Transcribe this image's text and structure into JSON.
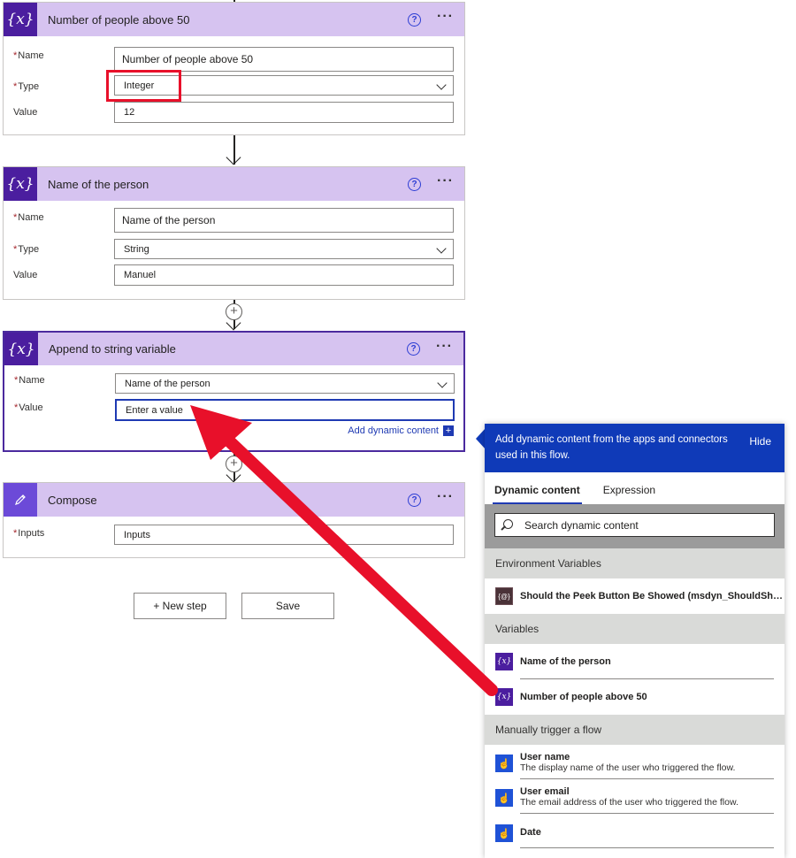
{
  "cards": {
    "people_above_50": {
      "icon": "{x}",
      "title": "Number of people above 50",
      "name_label": "Name",
      "name_value": "Number of people above 50",
      "type_label": "Type",
      "type_value": "Integer",
      "value_label": "Value",
      "value_value": "12"
    },
    "name_person": {
      "icon": "{x}",
      "title": "Name of the person",
      "name_label": "Name",
      "name_value": "Name of the person",
      "type_label": "Type",
      "type_value": "String",
      "value_label": "Value",
      "value_value": "Manuel"
    },
    "append": {
      "icon": "{x}",
      "title": "Append to string variable",
      "name_label": "Name",
      "name_value": "Name of the person",
      "value_label": "Value",
      "value_placeholder": "Enter a value",
      "dynamic_link": "Add dynamic content",
      "dynamic_plus": "+"
    },
    "compose": {
      "title": "Compose",
      "inputs_label": "Inputs",
      "inputs_value": "Inputs"
    }
  },
  "common": {
    "required_mark": "*",
    "help_glyph": "?",
    "more_glyph": "···",
    "plus_glyph": "+"
  },
  "buttons": {
    "new_step": "+ New step",
    "save": "Save"
  },
  "panel": {
    "banner": "Add dynamic content from the apps and connectors used in this flow.",
    "hide": "Hide",
    "tabs": [
      "Dynamic content",
      "Expression"
    ],
    "search_placeholder": "Search dynamic content",
    "sections": {
      "env": "Environment Variables",
      "vars": "Variables",
      "trigger": "Manually trigger a flow"
    },
    "env_item": "Should the Peek Button Be Showed (msdyn_ShouldShowPeekButton)",
    "env_icon": "{@}",
    "var_items": [
      "Name of the person",
      "Number of people above 50"
    ],
    "trigger_items": [
      {
        "title": "User name",
        "desc": "The display name of the user who triggered the flow."
      },
      {
        "title": "User email",
        "desc": "The email address of the user who triggered the flow."
      },
      {
        "title": "Date",
        "desc": ""
      }
    ]
  },
  "colors": {
    "card_header": "#d6c3f0",
    "variable_icon": "#4b1e9f",
    "panel_banner": "#0f3ab8",
    "annotation_red": "#e8102a"
  }
}
